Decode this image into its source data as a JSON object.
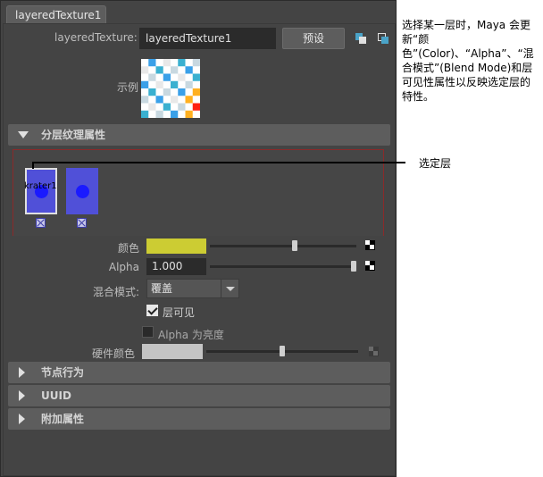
{
  "tab": {
    "label": "layeredTexture1"
  },
  "header": {
    "name_label": "layeredTexture:",
    "name_value": "layeredTexture1",
    "preset_label": "预设"
  },
  "sample": {
    "label": "示例"
  },
  "sections": {
    "layered_attrs": "分层纹理属性",
    "node_behavior": "节点行为",
    "uuid": "UUID",
    "extra_attrs": "附加属性"
  },
  "layers": {
    "selected_name": "krater1"
  },
  "attributes": {
    "color_label": "颜色",
    "color_value": "#cccc33",
    "color_slider": 0.58,
    "alpha_label": "Alpha",
    "alpha_value": "1.000",
    "alpha_slider": 1.0,
    "blend_label": "混合模式:",
    "blend_value": "覆盖",
    "layer_visible_label": "层可见",
    "layer_visible_checked": true,
    "alpha_is_luminance_label": "Alpha 为亮度",
    "alpha_is_luminance_checked": false,
    "hw_color_label": "硬件颜色",
    "hw_color_slider": 0.5
  },
  "annotations": {
    "description": "选择某一层时，Maya 会更新“颜色”(Color)、“Alpha”、“混合模式”(Blend Mode)和层可见性属性以反映选定层的特性。",
    "callout": "选定层"
  }
}
